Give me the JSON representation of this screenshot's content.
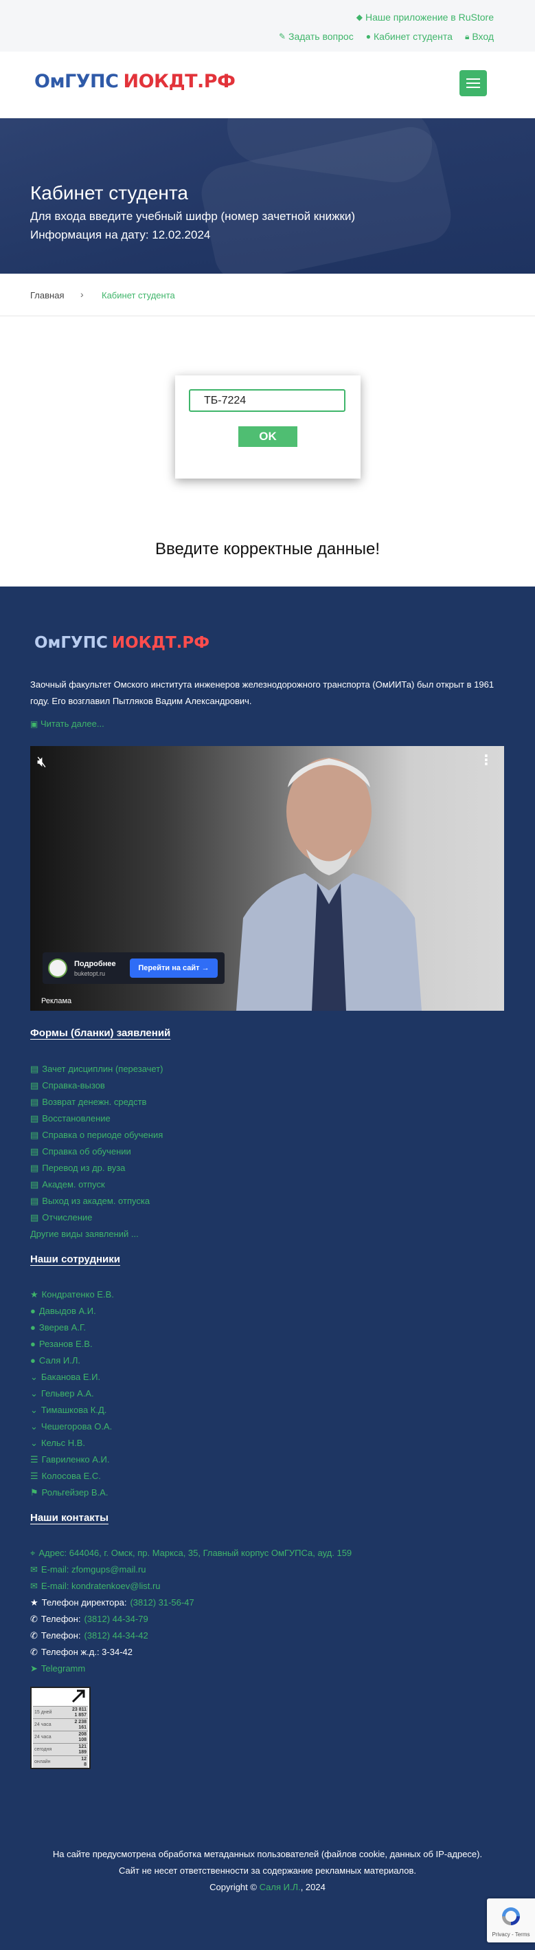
{
  "topbar": {
    "app_link": "Наше приложение в RuStore",
    "ask_question": "Задать вопрос",
    "student_cabinet": "Кабинет студента",
    "login": "Вход"
  },
  "header": {
    "logo_part1": "ОмГУПС",
    "logo_part2": "ИОКДТ.РФ"
  },
  "hero": {
    "title": "Кабинет студента",
    "subtitle": "Для входа введите учебный шифр (номер зачетной книжки)",
    "info": "Информация на дату: 12.02.2024"
  },
  "breadcrumb": {
    "home": "Главная",
    "separator": "›",
    "current": "Кабинет студента"
  },
  "login_form": {
    "input_value": "ТБ-7224",
    "ok_button": "OK",
    "error_message": "Введите корректные данные!"
  },
  "footer": {
    "logo_part1": "ОмГУПС",
    "logo_part2": "ИОКДТ.РФ",
    "about": "Заочный факультет Омского института инженеров железнодорожного транспорта (ОмИИТа) был открыт в 1961 году. Его возглавил Пытляков Вадим Александрович.",
    "read_more": "Читать далее...",
    "video_ad": {
      "more": "Подробнее",
      "domain": "buketopt.ru",
      "goto_button": "Перейти на сайт",
      "ad_label": "Реклама"
    },
    "forms_title": "Формы (бланки) заявлений",
    "forms": [
      "Зачет дисциплин (перезачет)",
      "Справка-вызов",
      "Возврат денежн. средств",
      "Восстановление",
      "Справка о периоде обучения",
      "Справка об обучении",
      "Перевод из др. вуза",
      "Академ. отпуск",
      "Выход из академ. отпуска",
      "Отчисление"
    ],
    "forms_other": "Другие виды заявлений ...",
    "staff_title": "Наши сотрудники",
    "staff": [
      {
        "name": "Кондратенко Е.В.",
        "icon": "star-icon"
      },
      {
        "name": "Давыдов А.И.",
        "icon": "user-icon"
      },
      {
        "name": "Зверев А.Г.",
        "icon": "user-icon"
      },
      {
        "name": "Резанов Е.В.",
        "icon": "user-icon"
      },
      {
        "name": "Саля И.Л.",
        "icon": "user-icon"
      },
      {
        "name": "Баканова Е.И.",
        "icon": "chevron-down-icon"
      },
      {
        "name": "Гельвер А.А.",
        "icon": "chevron-down-icon"
      },
      {
        "name": "Тимашкова К.Д.",
        "icon": "chevron-down-icon"
      },
      {
        "name": "Чешегорова О.А.",
        "icon": "chevron-down-icon"
      },
      {
        "name": "Кельс Н.В.",
        "icon": "chevron-down-icon"
      },
      {
        "name": "Гавриленко А.И.",
        "icon": "list-icon"
      },
      {
        "name": "Колосова Е.С.",
        "icon": "list-icon"
      },
      {
        "name": "Рольгейзер В.А.",
        "icon": "flag-icon"
      }
    ],
    "contacts_title": "Наши контакты",
    "contacts": {
      "address": "Адрес: 644046, г. Омск, пр. Маркса, 35, Главный корпус ОмГУПСа, ауд. 159",
      "email1": "E-mail: zfomgups@mail.ru",
      "email2": "E-mail: kondratenkoev@list.ru",
      "director_label": "Телефон директора:",
      "director_phone": "(3812) 31-56-47",
      "phone1_label": "Телефон:",
      "phone1": "(3812) 44-34-79",
      "phone2_label": "Телефон:",
      "phone2": "(3812) 44-34-42",
      "rail_phone": "Телефон ж.д.: 3-34-42",
      "telegram": "Telegramm"
    },
    "counter": {
      "rows": [
        {
          "k": "15 дней",
          "v": "23 811\n1 857"
        },
        {
          "k": "24 часа",
          "v": "2 238\n161"
        },
        {
          "k": "24 часа",
          "v": "208\n108"
        },
        {
          "k": "сегодня",
          "v": "121\n189"
        },
        {
          "k": "онлайн",
          "v": "12\n8"
        }
      ]
    },
    "notice1": "На сайте предусмотрена обработка метаданных пользователей (файлов cookie, данных об IP-адресе).",
    "notice2": "Сайт не несет ответственности за содержание рекламных материалов.",
    "copyright_prefix": "Copyright ©",
    "copyright_name": "Саля И.Л.",
    "copyright_year": ", 2024"
  },
  "recaptcha": {
    "text": "Privacy - Terms"
  },
  "colors": {
    "accent": "#3fb56a",
    "footer_bg": "#1e3663",
    "logo_blue": "#2f5aa8",
    "logo_red": "#e2333a"
  }
}
